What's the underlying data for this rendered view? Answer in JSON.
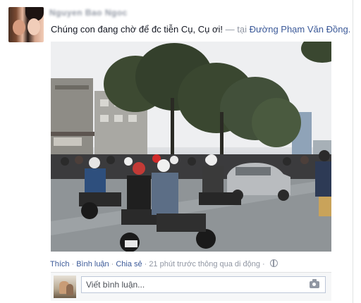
{
  "post": {
    "author_name": "Nguyen Bao Ngoc",
    "status_text": "Chúng con đang chờ để đc tiễn Cụ, Cụ ơi!",
    "separator": "—",
    "at_prefix": "tại",
    "place_name": "Đường Phạm Văn Đồng."
  },
  "actions": {
    "like": "Thích",
    "comment": "Bình luận",
    "share": "Chia sẻ",
    "timestamp": "21 phút trước thông qua di động",
    "dot": "·"
  },
  "comment": {
    "placeholder": "Viết bình luận..."
  },
  "icons": {
    "privacy": "globe-icon",
    "photo_upload": "camera-icon"
  },
  "colors": {
    "link": "#3b5998",
    "meta": "#9197a3",
    "text": "#141823"
  }
}
